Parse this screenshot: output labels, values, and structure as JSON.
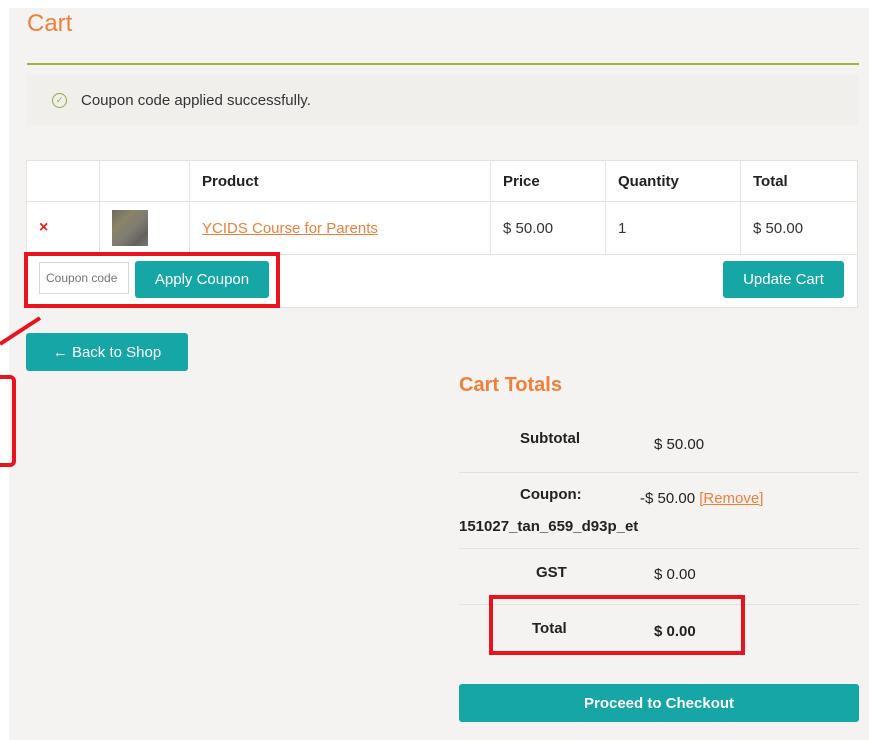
{
  "page": {
    "title": "Cart"
  },
  "notice": {
    "message": "Coupon code applied successfully.",
    "icon": "check-circle-icon"
  },
  "cart_table": {
    "headers": [
      "",
      "",
      "Product",
      "Price",
      "Quantity",
      "Total"
    ],
    "rows": [
      {
        "remove": "×",
        "product": "YCIDS Course for Parents",
        "price": "$ 50.00",
        "quantity": "1",
        "total": "$ 50.00"
      }
    ]
  },
  "coupon": {
    "placeholder": "Coupon code",
    "apply_label": "Apply Coupon"
  },
  "update_label": "Update Cart",
  "back_label": "← Back to Shop",
  "totals": {
    "title": "Cart Totals",
    "subtotal_label": "Subtotal",
    "subtotal_value": "$ 50.00",
    "coupon_label": "Coupon:",
    "coupon_code": "151027_tan_659_d93p_et",
    "coupon_value": "-$ 50.00",
    "remove_label": "[Remove]",
    "gst_label": "GST",
    "gst_value": "$ 0.00",
    "total_label": "Total",
    "total_value": "$ 0.00"
  },
  "checkout_label": "Proceed to Checkout",
  "colors": {
    "accent": "#16a6a6",
    "heading": "#ef7f3a",
    "highlight": "#e8131d",
    "success": "#8cae3c"
  }
}
